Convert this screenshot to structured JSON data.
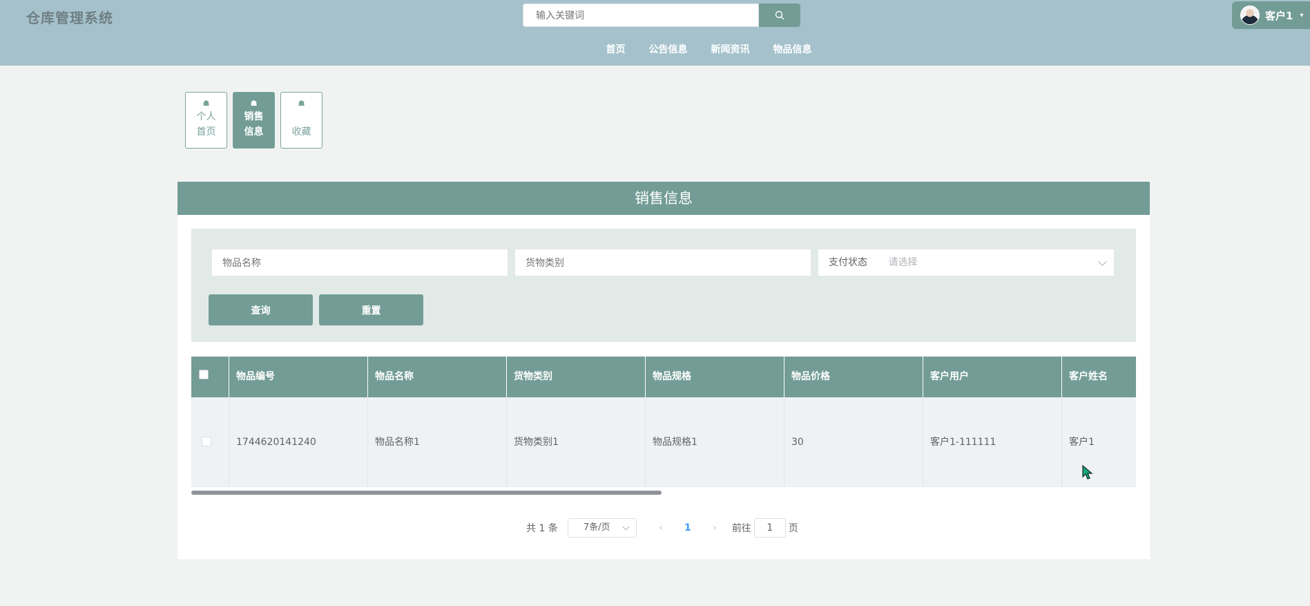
{
  "header": {
    "brand": "仓库管理系统",
    "search_placeholder": "输入关键词",
    "nav": [
      "首页",
      "公告信息",
      "新闻资讯",
      "物品信息"
    ],
    "user_name": "客户1"
  },
  "mini_menu": [
    {
      "line1": "个人",
      "line2": "首页"
    },
    {
      "line1": "销售",
      "line2": "信息"
    },
    {
      "line1": "",
      "line2": "收藏"
    }
  ],
  "panel": {
    "title": "销售信息",
    "filters": {
      "name_placeholder": "物品名称",
      "category_placeholder": "货物类别",
      "pay_status_label": "支付状态",
      "pay_status_placeholder": "请选择"
    },
    "buttons": {
      "query": "查询",
      "reset": "重置"
    }
  },
  "table": {
    "columns": [
      "物品编号",
      "物品名称",
      "货物类别",
      "物品规格",
      "物品价格",
      "客户用户",
      "客户姓名"
    ],
    "rows": [
      [
        "1744620141240",
        "物品名称1",
        "货物类别1",
        "物品规格1",
        "30",
        "客户1-111111",
        "客户1"
      ]
    ]
  },
  "pagination": {
    "total": "共 1 条",
    "page_size": "7条/页",
    "current_page": "1",
    "goto_prefix": "前往",
    "goto_value": "1",
    "goto_suffix": "页"
  },
  "colors": {
    "header_bg": "#a5c2cc",
    "accent": "#729c95",
    "page_bg": "#f1f3f2",
    "filter_bg": "#e2eae8"
  }
}
